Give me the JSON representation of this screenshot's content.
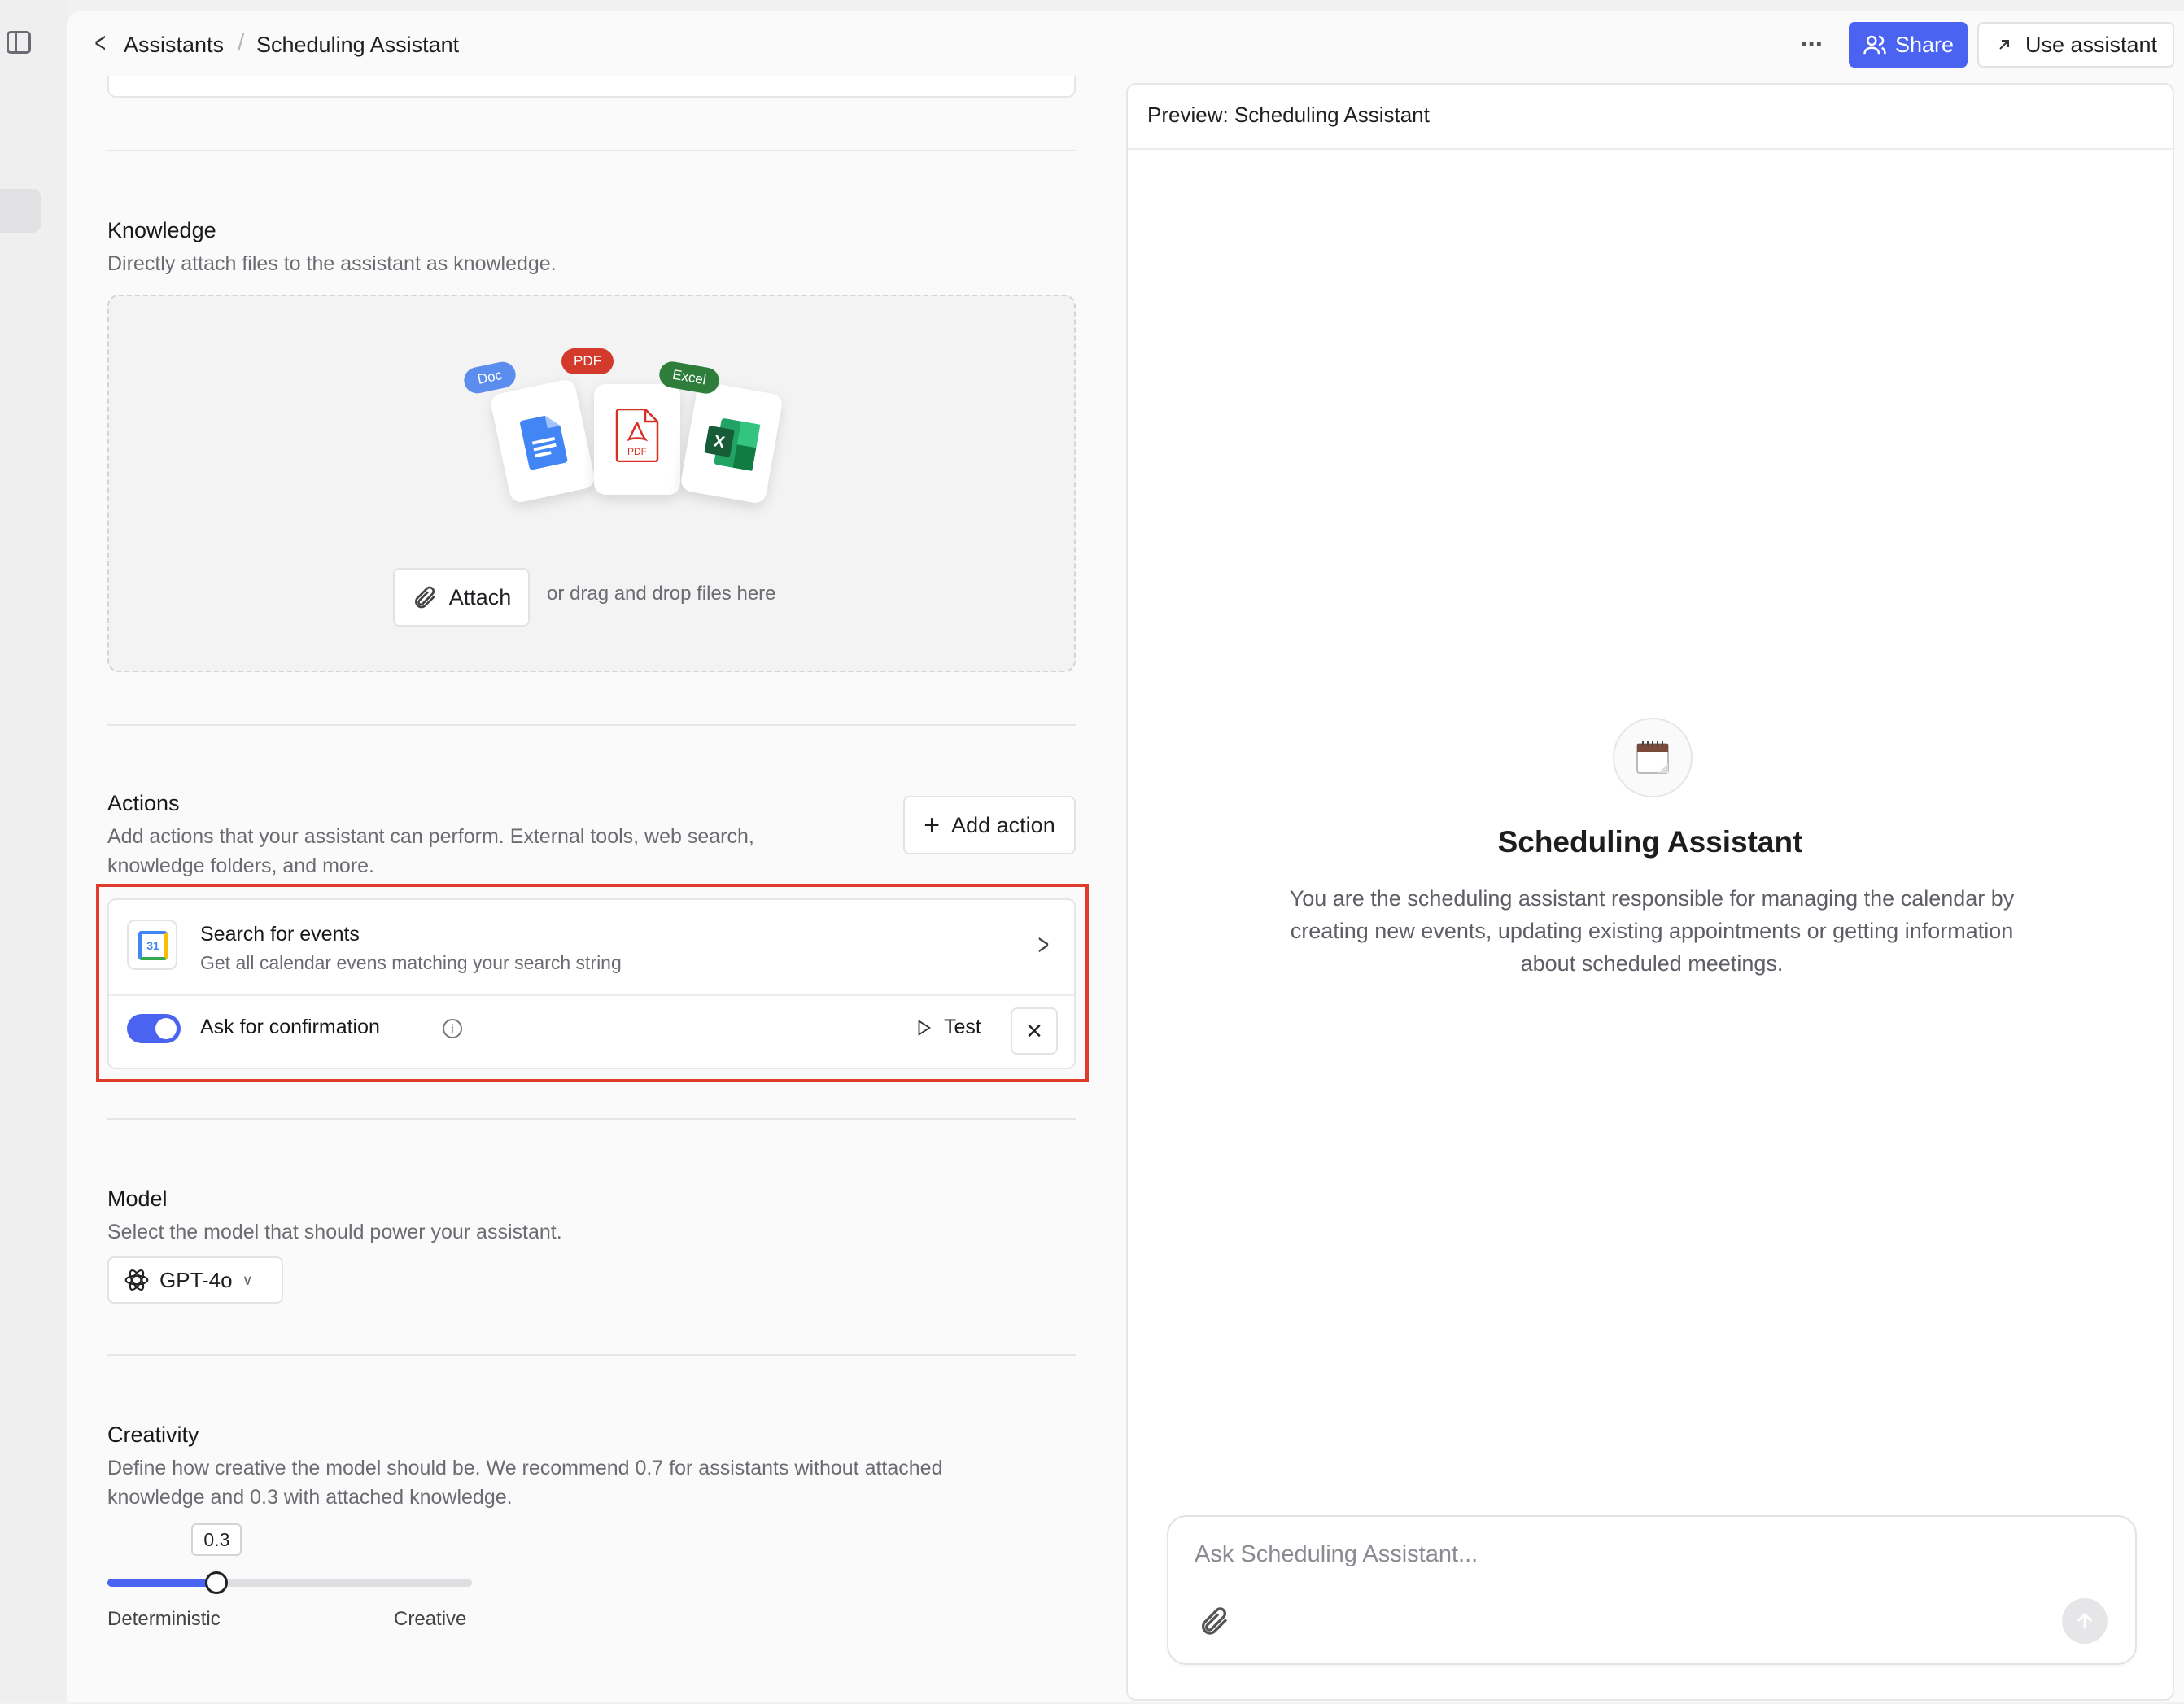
{
  "breadcrumb": {
    "parent": "Assistants",
    "current": "Scheduling Assistant"
  },
  "header": {
    "share_label": "Share",
    "use_label": "Use assistant"
  },
  "knowledge": {
    "title": "Knowledge",
    "description": "Directly attach files to the assistant as knowledge.",
    "file_tags": [
      "Doc",
      "PDF",
      "Excel"
    ],
    "pdf_card_label": "PDF",
    "attach_label": "Attach",
    "drag_text": "or drag and drop files here"
  },
  "actions": {
    "title": "Actions",
    "description_line1": "Add actions that your assistant can perform. External tools, web search,",
    "description_line2": "knowledge folders, and more.",
    "add_label": "Add action",
    "item": {
      "calendar_day": "31",
      "title": "Search for events",
      "description": "Get all calendar evens matching your search string",
      "confirm_label": "Ask for confirmation",
      "confirm_enabled": true,
      "test_label": "Test"
    }
  },
  "model": {
    "title": "Model",
    "description": "Select the model that should power your assistant.",
    "selected": "GPT-4o"
  },
  "creativity": {
    "title": "Creativity",
    "description_line1": "Define how creative the model should be. We recommend 0.7 for assistants without attached",
    "description_line2": "knowledge and 0.3 with attached knowledge.",
    "value": 0.3,
    "value_label": "0.3",
    "min_label": "Deterministic",
    "max_label": "Creative"
  },
  "preview": {
    "header": "Preview: Scheduling Assistant",
    "title": "Scheduling Assistant",
    "description": "You are the scheduling assistant responsible for managing the calendar by creating new events, updating existing appointments or getting information about scheduled meetings.",
    "input_placeholder": "Ask Scheduling Assistant..."
  },
  "colors": {
    "accent": "#4a63f0",
    "highlight": "#e03c2b"
  }
}
